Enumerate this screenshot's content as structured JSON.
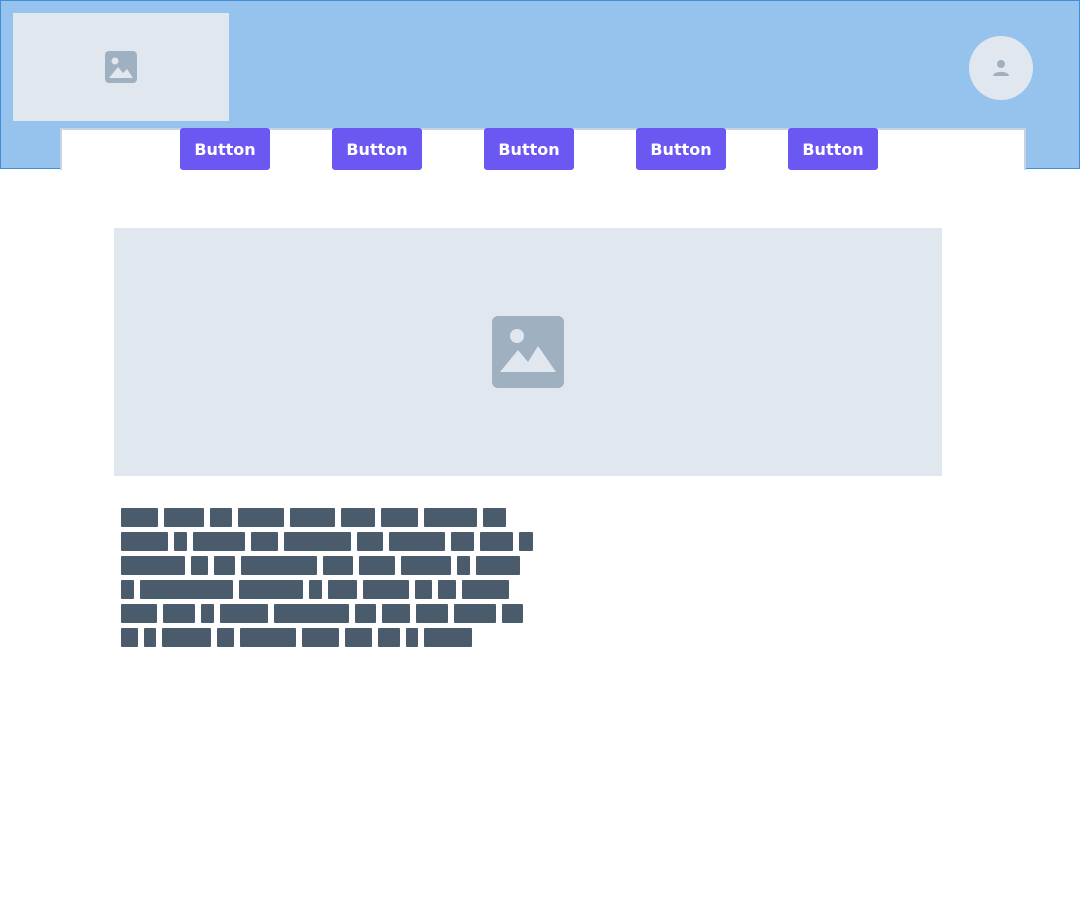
{
  "header": {
    "background": "#95c3ed",
    "logo": {
      "icon": "image-placeholder-icon"
    },
    "avatar": {
      "icon": "user-icon"
    }
  },
  "nav": {
    "buttons": [
      {
        "label": "Button"
      },
      {
        "label": "Button"
      },
      {
        "label": "Button"
      },
      {
        "label": "Button"
      },
      {
        "label": "Button"
      }
    ],
    "button_color": "#6b58f2"
  },
  "hero": {
    "icon": "image-placeholder-icon"
  },
  "text_block": {
    "style": "redacted placeholder text lines",
    "line_count": 6,
    "color": "#4a5c6c"
  }
}
